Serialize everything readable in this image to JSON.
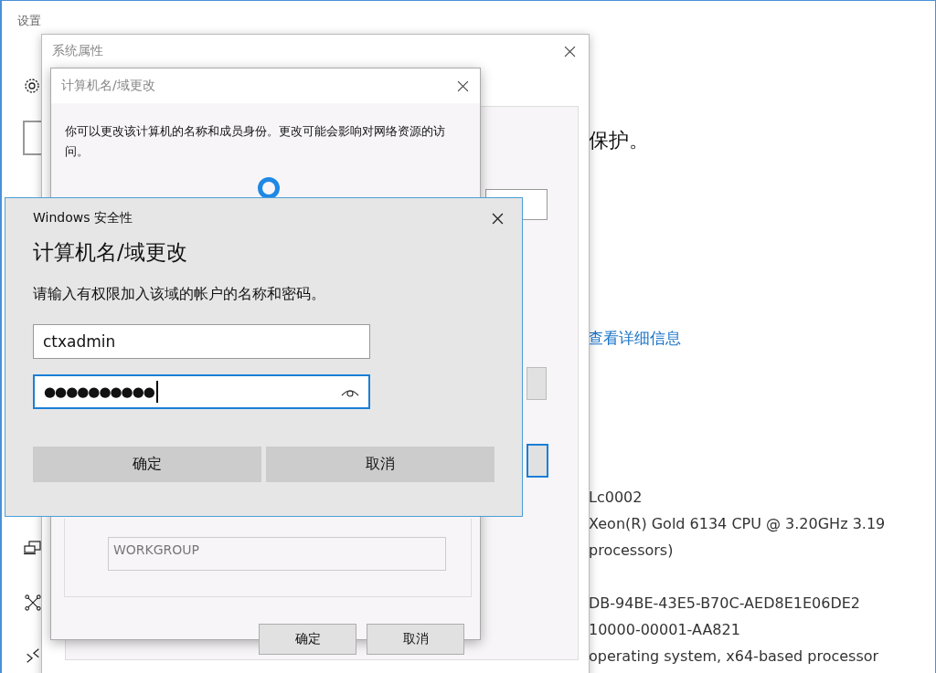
{
  "settings_window": {
    "title": "设置",
    "heading_partial": "保护。",
    "link": "查看详细信息",
    "info_lines": [
      "Lc0002",
      "Xeon(R) Gold 6134 CPU @ 3.20GHz   3.19",
      "processors)",
      "DB-94BE-43E5-B70C-AED8E1E06DE2",
      "10000-00001-AA821",
      "operating system, x64-based processor"
    ]
  },
  "system_properties": {
    "title": "系统属性"
  },
  "name_change_dialog": {
    "title": "计算机名/域更改",
    "description": "你可以更改该计算机的名称和成员身份。更改可能会影响对网络资源的访问。",
    "loading": true,
    "workgroup_value": "WORKGROUP",
    "buttons": [
      "确定",
      "取消"
    ]
  },
  "security_dialog": {
    "title": "Windows 安全性",
    "heading": "计算机名/域更改",
    "prompt": "请输入有权限加入该域的帐户的名称和密码。",
    "username": {
      "value": "ctxadmin",
      "focused": false
    },
    "password": {
      "value": "●●●●●●●●●●",
      "focused": true
    },
    "buttons": [
      "确定",
      "取消"
    ]
  }
}
